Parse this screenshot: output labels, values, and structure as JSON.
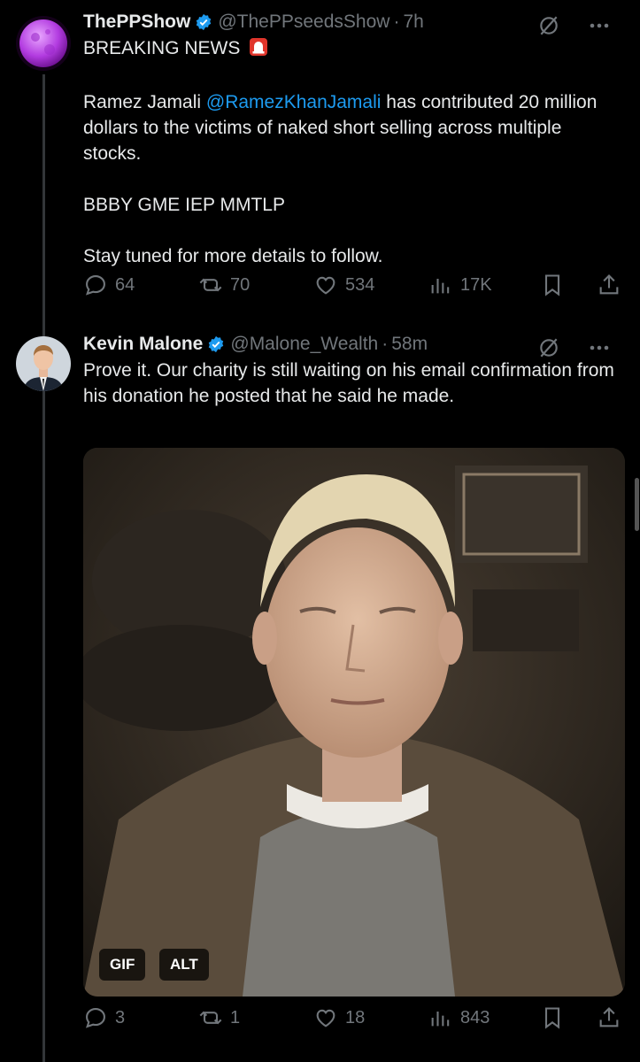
{
  "tweet1": {
    "name": "ThePPShow",
    "handle": "@ThePPseedsShow",
    "separator": "·",
    "time": "7h",
    "line1": "BREAKING NEWS",
    "para2_prefix": "Ramez Jamali ",
    "para2_mention": "@RamezKhanJamali",
    "para2_rest": " has contributed 20 million dollars to the victims of naked short selling across multiple stocks.",
    "para3": "BBBY GME IEP MMTLP",
    "para4": "Stay tuned for more details to follow.",
    "replies": "64",
    "reposts": "70",
    "likes": "534",
    "views": "17K"
  },
  "tweet2": {
    "name": "Kevin Malone",
    "handle": "@Malone_Wealth",
    "separator": "·",
    "time": "58m",
    "body": "Prove it. Our charity is still waiting on his email confirmation from his donation he posted that he said he made.",
    "gif_badge": "GIF",
    "alt_badge": "ALT",
    "replies": "3",
    "reposts": "1",
    "likes": "18",
    "views": "843"
  },
  "colors": {
    "background": "#000000",
    "text": "#e7e9ea",
    "secondary": "#71767b",
    "link": "#1d9bf0",
    "verified": "#1d9bf0"
  },
  "icons": [
    "verified-badge-icon",
    "siren-emoji-icon",
    "grok-icon",
    "more-icon",
    "reply-icon",
    "repost-icon",
    "like-icon",
    "views-icon",
    "bookmark-icon",
    "share-icon"
  ]
}
